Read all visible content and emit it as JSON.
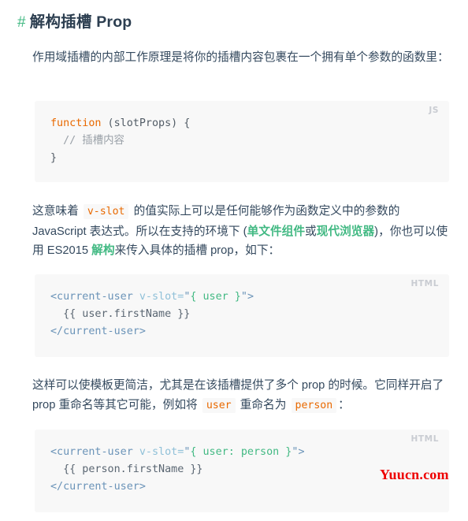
{
  "heading": {
    "anchor": "#",
    "text": "解构插槽 Prop"
  },
  "paragraphs": {
    "p1": {
      "part1": "作用域插槽的内部工作原理是将你的插槽内容包裹在一个拥有单个参数的函数里："
    },
    "p2": {
      "part1": "这意味着 ",
      "code1": "v-slot",
      "part2": " 的值实际上可以是任何能够作为函数定义中的参数的 JavaScript 表达式。所以在支持的环境下 (",
      "link1": "单文件组件",
      "part3": "或",
      "link2": "现代浏览器",
      "part4": ")，你也可以使用 ES2015 ",
      "link3": "解构",
      "part5": "来传入具体的插槽 prop，如下："
    },
    "p3": {
      "part1": "这样可以使模板更简洁，尤其是在该插槽提供了多个 prop 的时候。它同样开启了 prop 重命名等其它可能，例如将 ",
      "code1": "user",
      "part2": " 重命名为 ",
      "code2": "person",
      "part3": "："
    }
  },
  "code_blocks": {
    "js_block": {
      "lang_label": "JS",
      "line1_keyword": "function",
      "line1_rest": " (slotProps) {",
      "line2_comment": "  // 插槽内容",
      "line3": "}"
    },
    "html_block_1": {
      "lang_label": "HTML",
      "line1_tag_open": "<current-user",
      "line1_attr": " v-slot=",
      "line1_quote_open": "\"",
      "line1_string": "{ user }",
      "line1_quote_close": "\"",
      "line1_tag_close": ">",
      "line2": "  {{ user.firstName }}",
      "line3": "</current-user>"
    },
    "html_block_2": {
      "lang_label": "HTML",
      "line1_tag_open": "<current-user",
      "line1_attr": " v-slot=",
      "line1_quote_open": "\"",
      "line1_string": "{ user: person }",
      "line1_quote_close": "\"",
      "line1_tag_close": ">",
      "line2": "  {{ person.firstName }}",
      "line3": "</current-user>"
    }
  },
  "watermark": {
    "text": "Yuucn.com"
  },
  "colors": {
    "brand_green": "#42b983",
    "heading": "#2c3e50",
    "body_text": "#34495e",
    "inline_code": "#e96900",
    "code_bg": "#f8f8f8",
    "lang_label": "#c9ccd2",
    "watermark": "#ee0000"
  }
}
